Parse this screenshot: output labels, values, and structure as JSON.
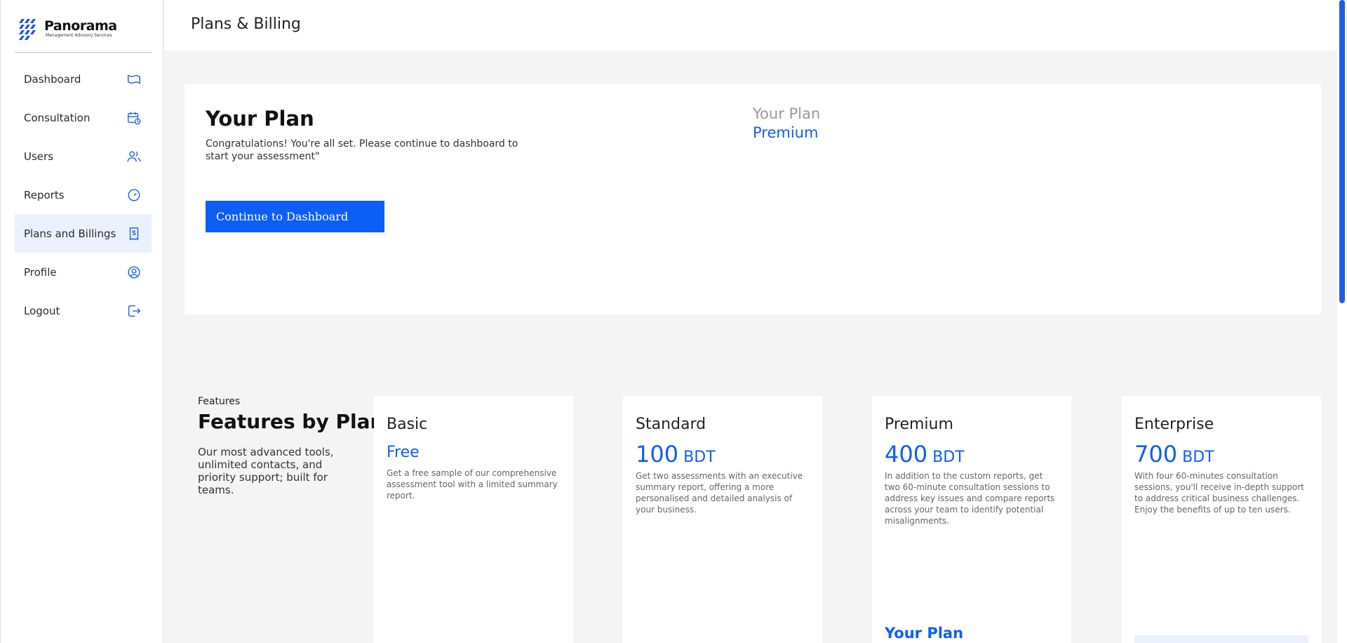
{
  "sidebar": {
    "logo": {
      "title": "Panorama",
      "subtitle": "Management Advisory Services"
    },
    "items": [
      {
        "label": "Dashboard",
        "icon": "map-icon"
      },
      {
        "label": "Consultation",
        "icon": "calendar-clock-icon"
      },
      {
        "label": "Users",
        "icon": "users-icon"
      },
      {
        "label": "Reports",
        "icon": "gauge-icon"
      },
      {
        "label": "Plans and Billings",
        "icon": "receipt-dollar-icon",
        "active": true
      },
      {
        "label": "Profile",
        "icon": "user-circle-icon"
      },
      {
        "label": "Logout",
        "icon": "logout-icon"
      }
    ]
  },
  "header": {
    "title": "Plans & Billing"
  },
  "plan": {
    "heading": "Your Plan",
    "message": "Congratulations! You're all set. Please continue to dashboard to start your assessment\"",
    "button_label": "Continue to Dashboard",
    "current_label": "Your Plan",
    "current_value": "Premium"
  },
  "features": {
    "kicker": "Features",
    "heading": "Features by Plan",
    "description": "Our most advanced tools, unlimited contacts, and priority support; built for teams.",
    "tiers": [
      {
        "name": "Basic",
        "price": "Free",
        "currency": "",
        "description": "Get a free sample of our comprehensive assessment tool with a limited summary report."
      },
      {
        "name": "Standard",
        "price": "100",
        "currency": "BDT",
        "description": "Get two assessments with an executive summary report, offering a more personalised and detailed analysis of your business."
      },
      {
        "name": "Premium",
        "price": "400",
        "currency": "BDT",
        "description": "In addition to the custom reports, get two 60-minute consultation sessions to address key issues and compare reports across your team to identify potential misalignments.",
        "your_plan_label": "Your Plan"
      },
      {
        "name": "Enterprise",
        "price": "700",
        "currency": "BDT",
        "description": "With four 60-minutes consultation sessions, you'll receive in-depth support to address critical business challenges. Enjoy the benefits of up to ten users."
      }
    ]
  },
  "colors": {
    "accent": "#0d5ef5",
    "active_bg": "#ebf1fc",
    "background": "#f4f4f4"
  }
}
